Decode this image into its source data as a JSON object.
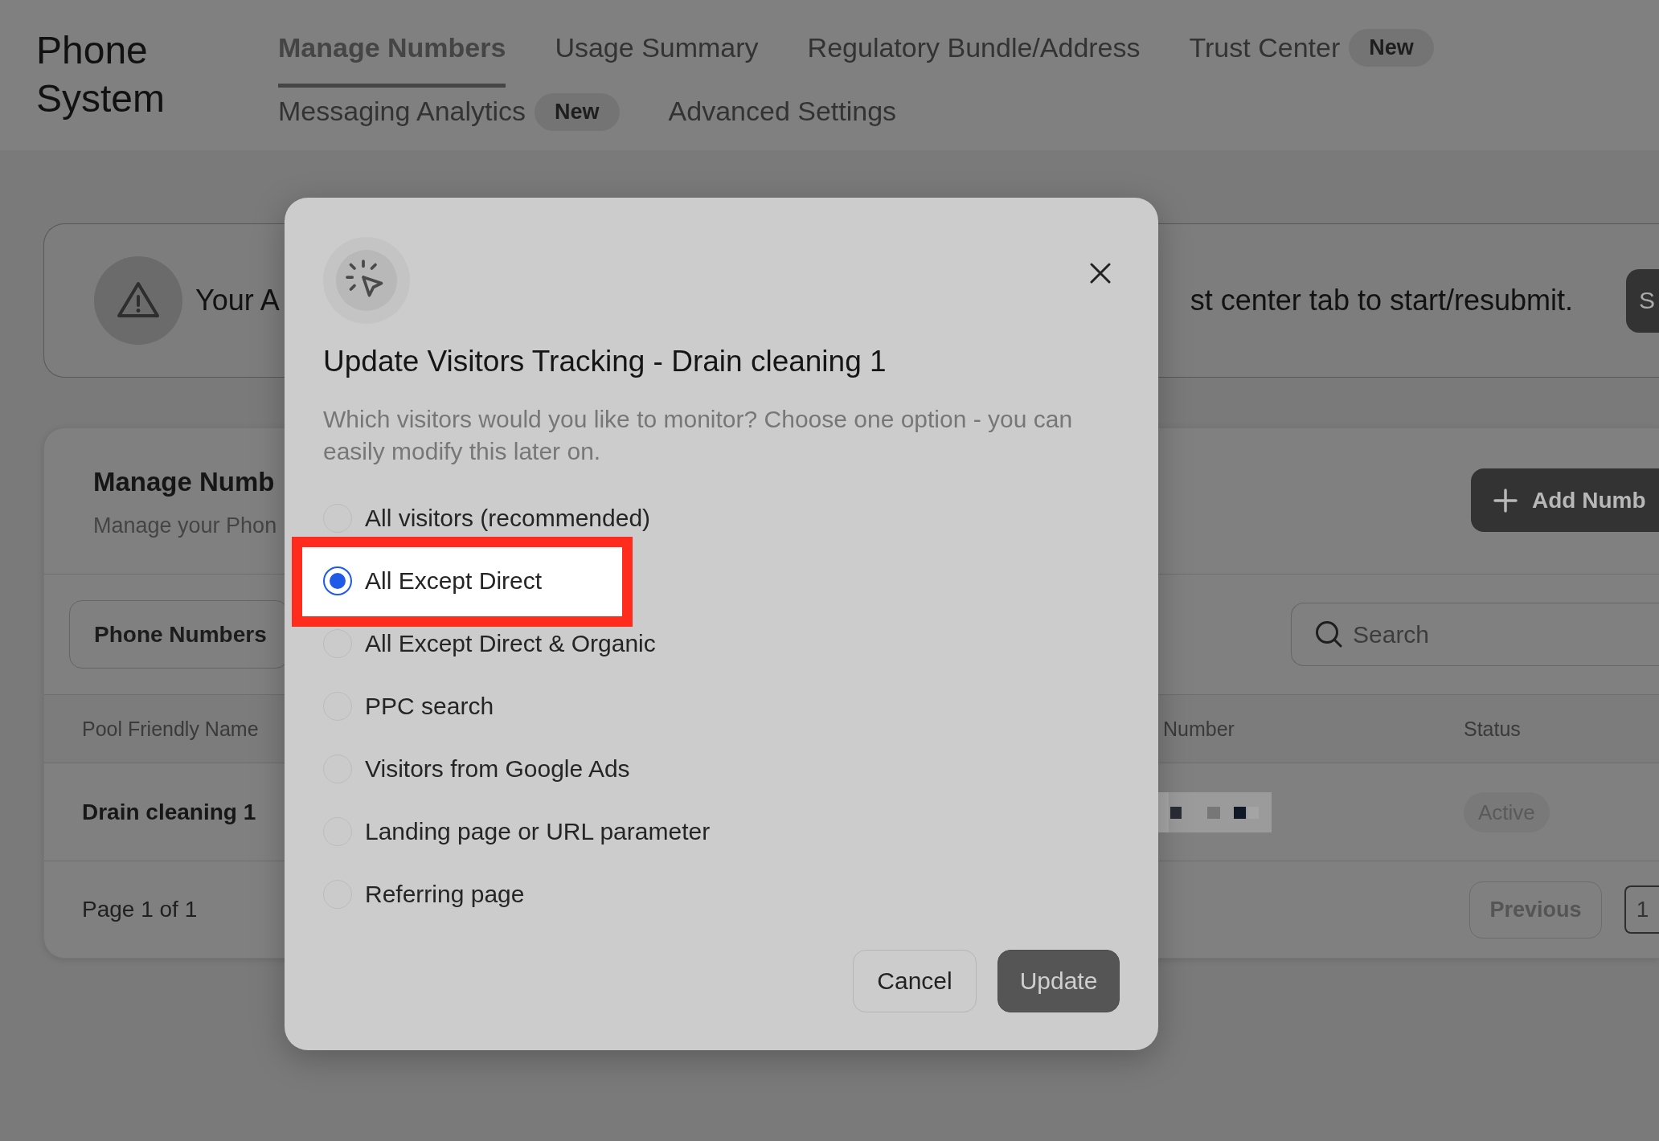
{
  "header": {
    "title": "Phone System",
    "tab_rows": [
      {
        "tabs": [
          {
            "label": "Manage Numbers",
            "selected": true
          },
          {
            "label": "Usage Summary",
            "selected": false
          },
          {
            "label": "Regulatory Bundle/Address",
            "selected": false
          },
          {
            "label": "Trust Center",
            "selected": false,
            "badge": "New"
          }
        ]
      },
      {
        "tabs": [
          {
            "label": "Messaging Analytics",
            "selected": false,
            "badge": "New"
          },
          {
            "label": "Advanced Settings",
            "selected": false
          }
        ]
      }
    ]
  },
  "banner": {
    "text_start": "Your A",
    "text_end": "st center tab to start/resubmit.",
    "button": "S"
  },
  "numbers_card": {
    "title": "Manage Numb",
    "subtitle": "Manage your Phon",
    "add_button": "Add Numb",
    "filter_button": "Phone Numbers",
    "search": {
      "placeholder": "Search"
    },
    "table": {
      "columns": [
        "Pool Friendly Name",
        "Number",
        "Status"
      ],
      "rows": [
        {
          "name": "Drain cleaning 1",
          "number_redacted": true,
          "status": "Active"
        }
      ]
    },
    "pagination": {
      "summary": "Page 1 of 1",
      "previous": "Previous",
      "pages": [
        {
          "label": "1",
          "selected": true
        }
      ]
    }
  },
  "modal": {
    "title": "Update Visitors Tracking - Drain cleaning 1",
    "description": "Which visitors would you like to monitor? Choose one option - you can easily modify this later on.",
    "options": [
      {
        "label": "All visitors (recommended)",
        "selected": false,
        "highlighted": false
      },
      {
        "label": "All Except Direct",
        "selected": true,
        "highlighted": true
      },
      {
        "label": "All Except Direct & Organic",
        "selected": false,
        "highlighted": false
      },
      {
        "label": "PPC search",
        "selected": false,
        "highlighted": false
      },
      {
        "label": "Visitors from Google Ads",
        "selected": false,
        "highlighted": false
      },
      {
        "label": "Landing page or URL parameter",
        "selected": false,
        "highlighted": false
      },
      {
        "label": "Referring page",
        "selected": false,
        "highlighted": false
      }
    ],
    "buttons": [
      {
        "label": "Cancel",
        "kind": "secondary"
      },
      {
        "label": "Update",
        "kind": "primary"
      }
    ]
  }
}
